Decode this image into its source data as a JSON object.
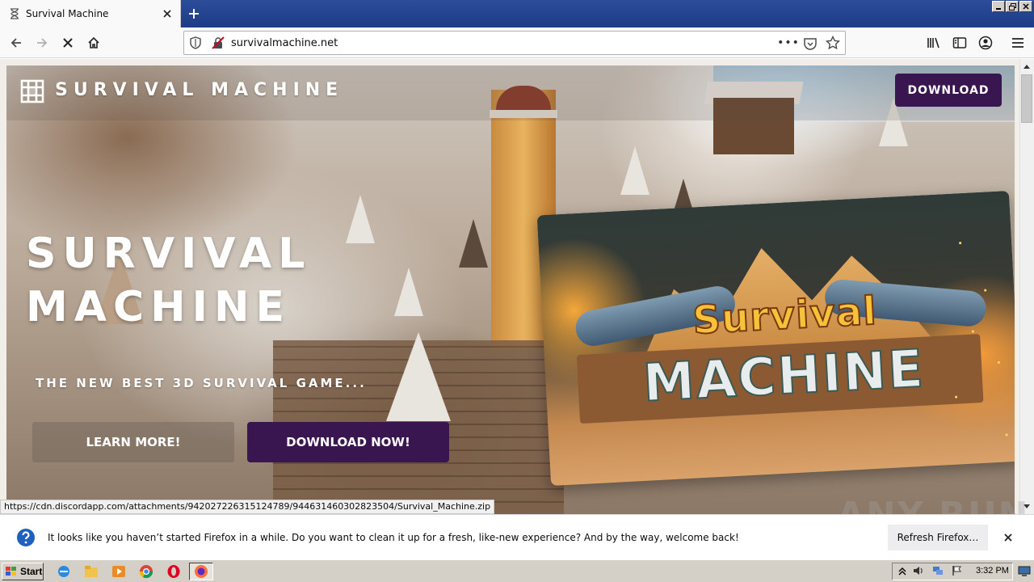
{
  "browser": {
    "tab_title": "Survival Machine",
    "url": "survivalmachine.net",
    "page_actions": "•••",
    "status_link": "https://cdn.discordapp.com/attachments/942027226315124789/944631460302823504/Survival_Machine.zip"
  },
  "site": {
    "logo_text": "SURVIVAL MACHINE",
    "header_download": "DOWNLOAD",
    "hero_title_line1": "SURVIVAL",
    "hero_title_line2": "MACHINE",
    "hero_subtitle": "THE NEW BEST 3D SURVIVAL GAME...",
    "learn_more": "LEARN MORE!",
    "download_now": "DOWNLOAD NOW!",
    "art_word1": "Survival",
    "art_word2": "MACHINE",
    "colors": {
      "accent_purple": "#3a1650",
      "art_yellow": "#f6c23a"
    }
  },
  "notification": {
    "message": "It looks like you haven’t started Firefox in a while. Do you want to clean it up for a fresh, like-new experience? And by the way, welcome back!",
    "button": "Refresh Firefox…"
  },
  "watermark": "ANY RUN",
  "taskbar": {
    "start_label": "Start",
    "clock": "3:32 PM"
  }
}
